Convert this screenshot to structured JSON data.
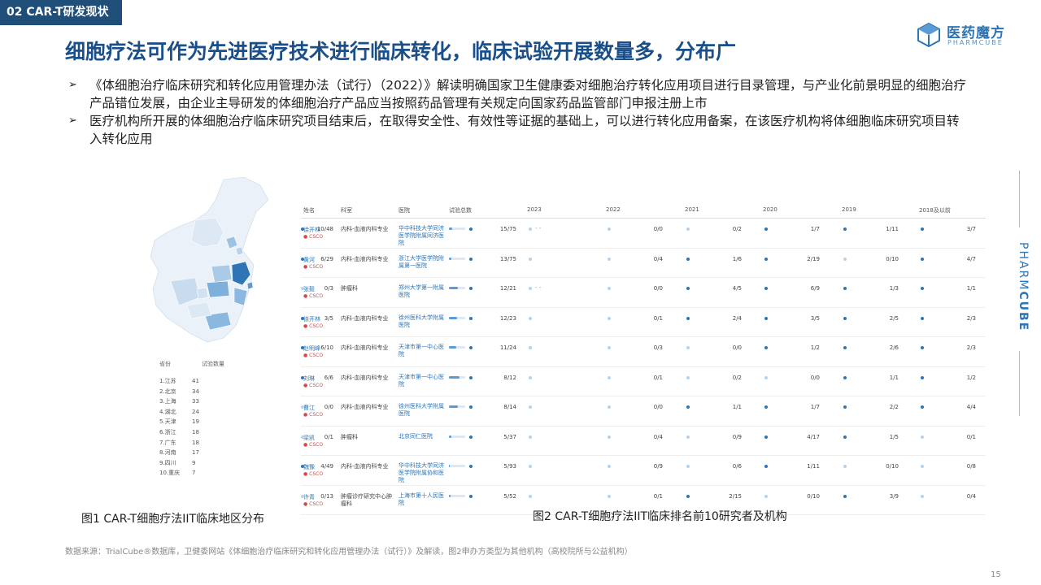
{
  "section_tag": "02 CAR-T研发现状",
  "title": "细胞疗法可作为先进医疗技术进行临床转化，临床试验开展数量多，分布广",
  "logo": {
    "name": "医药魔方",
    "sub": "PHARMCUBE"
  },
  "bullets": [
    "《体细胞治疗临床研究和转化应用管理办法（试行）（2022）》解读明确国家卫生健康委对细胞治疗转化应用项目进行目录管理，与产业化前景明显的细胞治疗产品错位发展，由企业主导研发的体细胞治疗产品应当按照药品管理有关规定向国家药品监管部门申报注册上市",
    "医疗机构所开展的体细胞治疗临床研究项目结束后，在取得安全性、有效性等证据的基础上，可以进行转化应用备案，在该医疗机构将体细胞临床研究项目转入转化应用"
  ],
  "bullet_mark": "➢",
  "side_brand": {
    "light": "PHARM",
    "bold": "CUBE"
  },
  "map_table": {
    "headers": [
      "省份",
      "试验数量"
    ],
    "rows": [
      {
        "prov": "1.江苏",
        "count": "41"
      },
      {
        "prov": "2.北京",
        "count": "34"
      },
      {
        "prov": "3.上海",
        "count": "33"
      },
      {
        "prov": "4.湖北",
        "count": "24"
      },
      {
        "prov": "5.天津",
        "count": "19"
      },
      {
        "prov": "6.浙江",
        "count": "18"
      },
      {
        "prov": "7.广东",
        "count": "18"
      },
      {
        "prov": "8.河南",
        "count": "17"
      },
      {
        "prov": "9.四川",
        "count": "9"
      },
      {
        "prov": "10.重庆",
        "count": "7"
      }
    ]
  },
  "table": {
    "headers": [
      "姓名",
      "科室",
      "医院",
      "试验总数",
      "2023",
      "2022",
      "2021",
      "2020",
      "2019",
      "2018及以前"
    ],
    "rows": [
      {
        "name": "徐开林",
        "dept": "内科-血液内科专业",
        "hosp": "华中科技大学同济医学院附属同济医院",
        "total": "15/75",
        "frac": 0.2,
        "years": [
          "- -",
          "0/0",
          "0/2",
          "1/7",
          "1/11",
          "3/7",
          "10/48"
        ]
      },
      {
        "name": "黄河",
        "dept": "内科-血液内科专业",
        "hosp": "浙江大学医学院附属第一医院",
        "total": "13/75",
        "frac": 0.17,
        "years": [
          "",
          "0/4",
          "1/6",
          "2/19",
          "0/10",
          "4/7",
          "6/29"
        ]
      },
      {
        "name": "张毅",
        "dept": "肿瘤科",
        "hosp": "郑州大学第一附属医院",
        "total": "12/21",
        "frac": 0.57,
        "years": [
          "- -",
          "0/0",
          "4/5",
          "6/9",
          "1/3",
          "1/1",
          "0/3"
        ]
      },
      {
        "name": "徐开林",
        "dept": "内科-血液内科专业",
        "hosp": "徐州医科大学附属医院",
        "total": "12/23",
        "frac": 0.52,
        "years": [
          "",
          "0/1",
          "2/4",
          "3/5",
          "2/5",
          "2/3",
          "3/5"
        ]
      },
      {
        "name": "赵明峰",
        "dept": "内科-血液内科专业",
        "hosp": "天津市第一中心医院",
        "total": "11/24",
        "frac": 0.46,
        "years": [
          "",
          "0/3",
          "0/0",
          "1/2",
          "2/6",
          "2/3",
          "6/10"
        ]
      },
      {
        "name": "刘琳",
        "dept": "内科-血液内科专业",
        "hosp": "天津市第一中心医院",
        "total": "8/12",
        "frac": 0.67,
        "years": [
          "",
          "0/1",
          "0/2",
          "0/0",
          "1/1",
          "1/2",
          "6/6"
        ]
      },
      {
        "name": "曹江",
        "dept": "内科-血液内科专业",
        "hosp": "徐州医科大学附属医院",
        "total": "8/14",
        "frac": 0.57,
        "years": [
          "",
          "0/0",
          "1/1",
          "1/7",
          "2/2",
          "4/4",
          "0/0"
        ]
      },
      {
        "name": "梁凯",
        "dept": "肿瘤科",
        "hosp": "北京同仁医院",
        "total": "5/37",
        "frac": 0.14,
        "years": [
          "",
          "0/4",
          "0/9",
          "4/17",
          "1/5",
          "0/1",
          "0/1"
        ]
      },
      {
        "name": "魏豫",
        "dept": "内科-血液内科专业",
        "hosp": "华中科技大学同济医学院附属协和医院",
        "total": "5/93",
        "frac": 0.05,
        "years": [
          "",
          "0/9",
          "0/6",
          "1/11",
          "0/10",
          "0/8",
          "4/49"
        ]
      },
      {
        "name": "许青",
        "dept": "肿瘤诊疗研究中心肿瘤科",
        "hosp": "上海市第十人民医院",
        "total": "5/52",
        "frac": 0.1,
        "years": [
          "",
          "0/1",
          "2/15",
          "0/10",
          "3/9",
          "0/4",
          "0/13"
        ]
      }
    ]
  },
  "caption1": "图1 CAR-T细胞疗法IIT临床地区分布",
  "caption2": "图2 CAR-T细胞疗法IIT临床排名前10研究者及机构",
  "source": "数据来源：TrialCube®数据库，卫健委网站《体细胞治疗临床研究和转化应用管理办法（试行）》及解读，图2申办方类型为其他机构（高校院所与公益机构）",
  "page_num": "15",
  "csco_badge": "● CSCO"
}
